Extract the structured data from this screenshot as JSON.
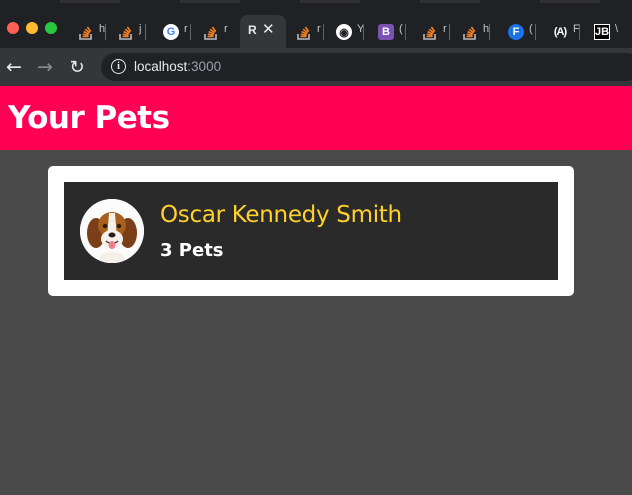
{
  "browser": {
    "tabs": [
      {
        "icon": "stackoverflow-icon",
        "title": "h",
        "active": false
      },
      {
        "icon": "stackoverflow-icon",
        "title": "j",
        "active": false
      },
      {
        "icon": "google-icon",
        "title": "r",
        "active": false
      },
      {
        "icon": "stackoverflow-icon",
        "title": "r",
        "active": false
      },
      {
        "icon": "none",
        "title": "R",
        "active": true
      },
      {
        "icon": "stackoverflow-icon",
        "title": "r",
        "active": false
      },
      {
        "icon": "github-icon",
        "title": "Y",
        "active": false
      },
      {
        "icon": "bootstrap-icon",
        "title": "(",
        "active": false
      },
      {
        "icon": "stackoverflow-icon",
        "title": "r",
        "active": false
      },
      {
        "icon": "stackoverflow-icon",
        "title": "h",
        "active": false
      },
      {
        "icon": "f-icon",
        "title": "(",
        "active": false
      },
      {
        "icon": "angular-icon",
        "title": "F",
        "active": false
      },
      {
        "icon": "jetbrains-icon",
        "title": "\\",
        "active": false
      }
    ],
    "close_glyph": "✕",
    "address": {
      "host": "localhost",
      "port": ":3000"
    }
  },
  "page": {
    "title": "Your Pets",
    "owner": {
      "name": "Oscar Kennedy Smith",
      "pets_label": "3 Pets",
      "avatar": "beagle-puppy-image"
    }
  },
  "colors": {
    "header": "#ff0055",
    "owner_name": "#ffd12a",
    "page_bg": "#4a4a4a",
    "card_inner": "#2a2a2a"
  }
}
